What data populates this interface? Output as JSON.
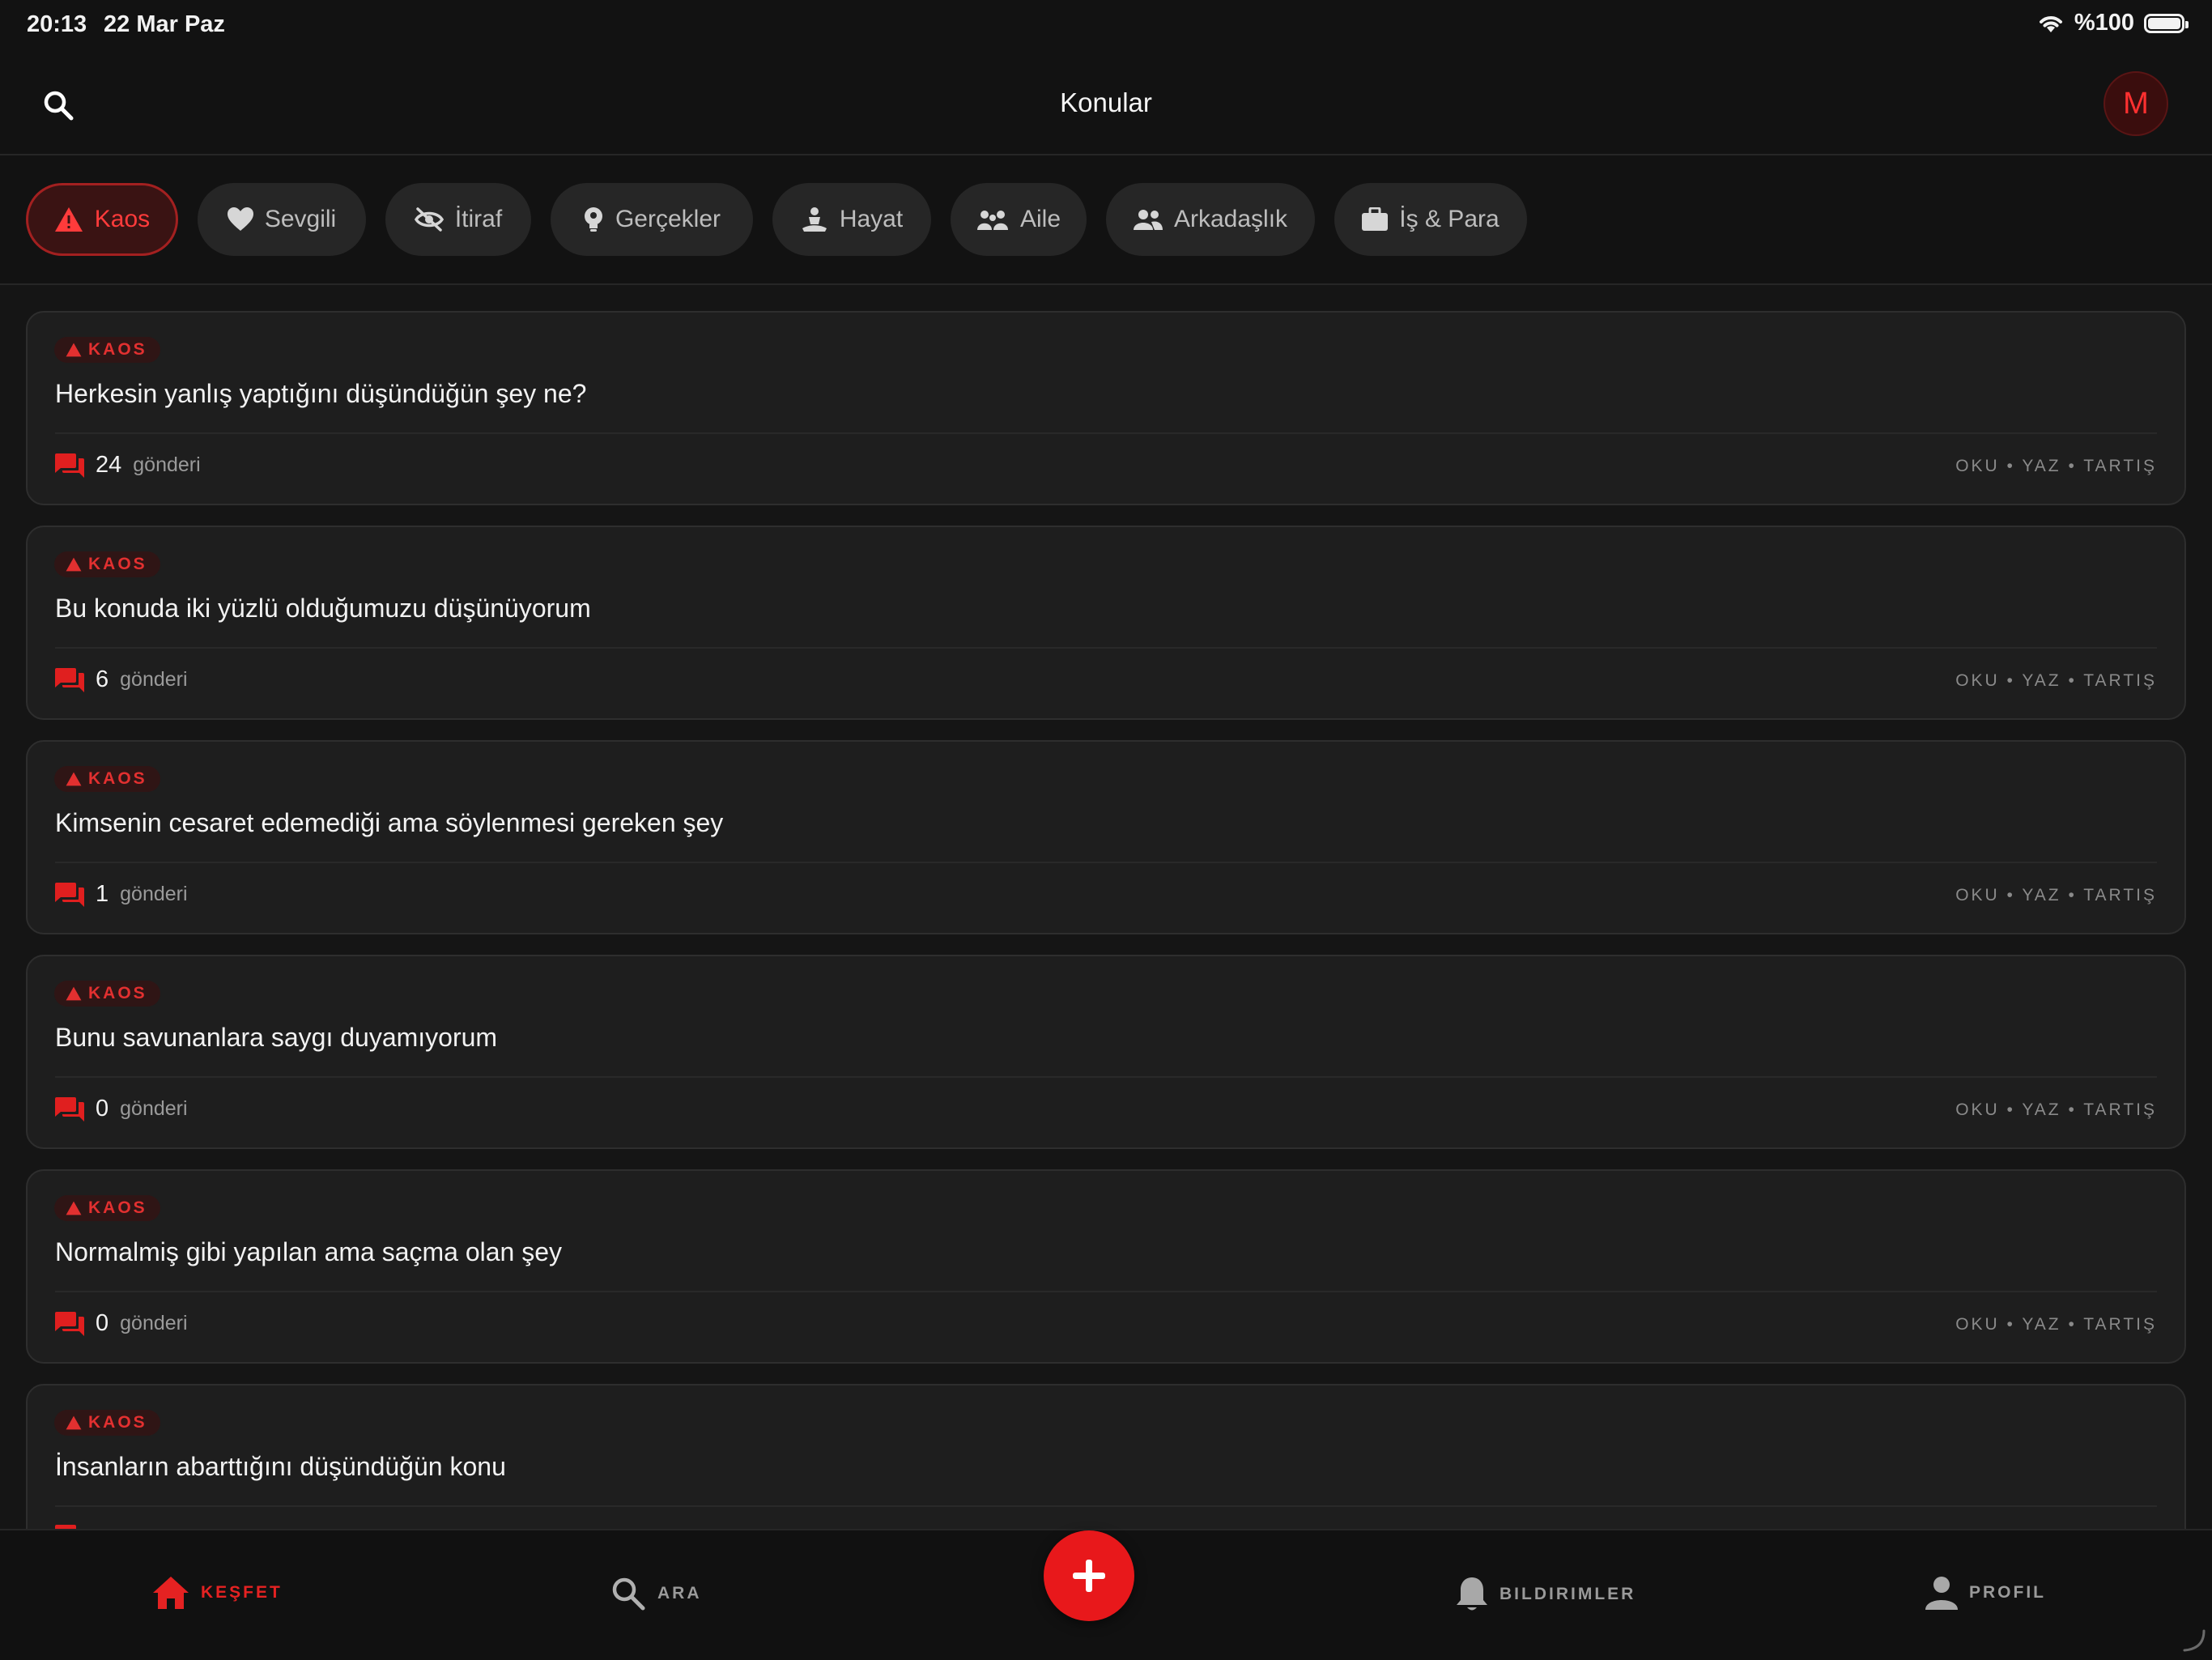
{
  "status_bar": {
    "time": "20:13",
    "date": "22 Mar Paz",
    "battery": "%100"
  },
  "header": {
    "title": "Konular",
    "avatar_initial": "M"
  },
  "categories": [
    {
      "label": "Kaos",
      "icon": "warning-icon",
      "active": true
    },
    {
      "label": "Sevgili",
      "icon": "heart-icon",
      "active": false
    },
    {
      "label": "İtiraf",
      "icon": "eye-off-icon",
      "active": false
    },
    {
      "label": "Gerçekler",
      "icon": "lightbulb-icon",
      "active": false
    },
    {
      "label": "Hayat",
      "icon": "meditation-icon",
      "active": false
    },
    {
      "label": "Aile",
      "icon": "family-icon",
      "active": false
    },
    {
      "label": "Arkadaşlık",
      "icon": "people-icon",
      "active": false
    },
    {
      "label": "İş & Para",
      "icon": "briefcase-icon",
      "active": false
    }
  ],
  "topics": [
    {
      "tag": "KAOS",
      "title": "Herkesin yanlış yaptığını düşündüğün şey ne?",
      "count": "24",
      "count_label": "gönderi",
      "actions": "OKU • YAZ • TARTIŞ"
    },
    {
      "tag": "KAOS",
      "title": "Bu konuda iki yüzlü olduğumuzu düşünüyorum",
      "count": "6",
      "count_label": "gönderi",
      "actions": "OKU • YAZ • TARTIŞ"
    },
    {
      "tag": "KAOS",
      "title": "Kimsenin cesaret edemediği ama söylenmesi gereken şey",
      "count": "1",
      "count_label": "gönderi",
      "actions": "OKU • YAZ • TARTIŞ"
    },
    {
      "tag": "KAOS",
      "title": "Bunu savunanlara saygı duyamıyorum",
      "count": "0",
      "count_label": "gönderi",
      "actions": "OKU • YAZ • TARTIŞ"
    },
    {
      "tag": "KAOS",
      "title": "Normalmiş gibi yapılan ama saçma olan şey",
      "count": "0",
      "count_label": "gönderi",
      "actions": "OKU • YAZ • TARTIŞ"
    },
    {
      "tag": "KAOS",
      "title": "İnsanların abarttığını düşündüğün konu",
      "count": "",
      "count_label": "",
      "actions": ""
    }
  ],
  "bottom_nav": {
    "items": [
      {
        "label": "KEŞFET",
        "icon": "home-icon",
        "active": true
      },
      {
        "label": "ARA",
        "icon": "search-icon",
        "active": false
      },
      {
        "label": "BILDIRIMLER",
        "icon": "bell-icon",
        "active": false
      },
      {
        "label": "PROFIL",
        "icon": "person-icon",
        "active": false
      }
    ],
    "fab_icon": "plus-icon"
  },
  "colors": {
    "accent": "#e8181b",
    "background": "#151515",
    "card": "#1e1e1e",
    "chip": "#262626"
  }
}
